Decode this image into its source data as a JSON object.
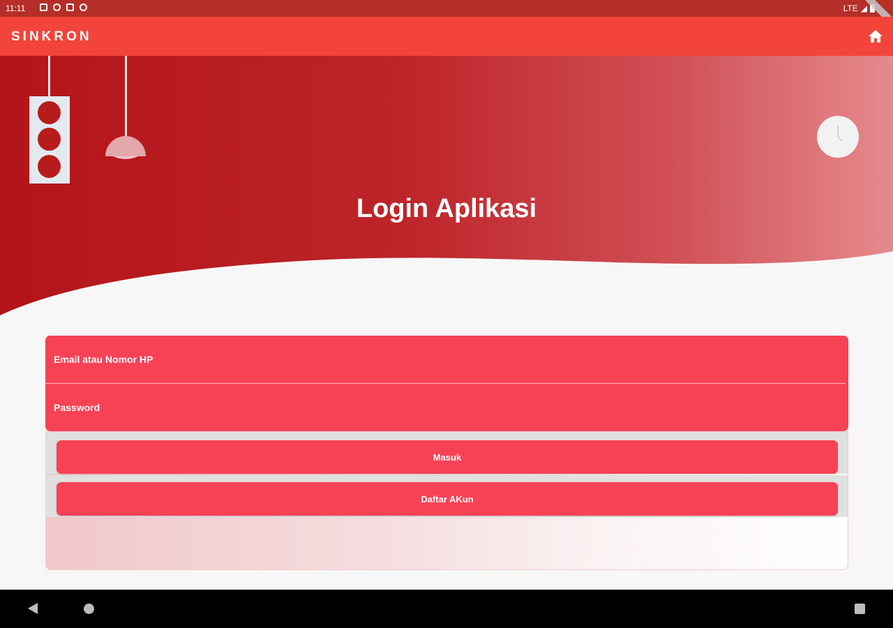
{
  "status_bar": {
    "time": "11:11",
    "network": "LTE"
  },
  "app_bar": {
    "title": "SINKRON",
    "home_icon": "home-icon"
  },
  "hero": {
    "title": "Login Aplikasi",
    "decorations": [
      "traffic-light-icon",
      "hanging-lamp-icon",
      "clock-icon"
    ]
  },
  "form": {
    "email_placeholder": "Email atau Nomor HP",
    "email_value": "",
    "password_placeholder": "Password",
    "password_value": ""
  },
  "buttons": {
    "login_label": "Masuk",
    "register_label": "Daftar AKun"
  },
  "colors": {
    "status_bar": "#b52f28",
    "app_bar": "#f2443a",
    "hero_dark": "#b71c1c",
    "accent": "#f74255",
    "background": "#f7f7f7"
  },
  "nav_bar": {
    "icons": [
      "back-icon",
      "home-circle-icon",
      "recents-icon"
    ]
  }
}
